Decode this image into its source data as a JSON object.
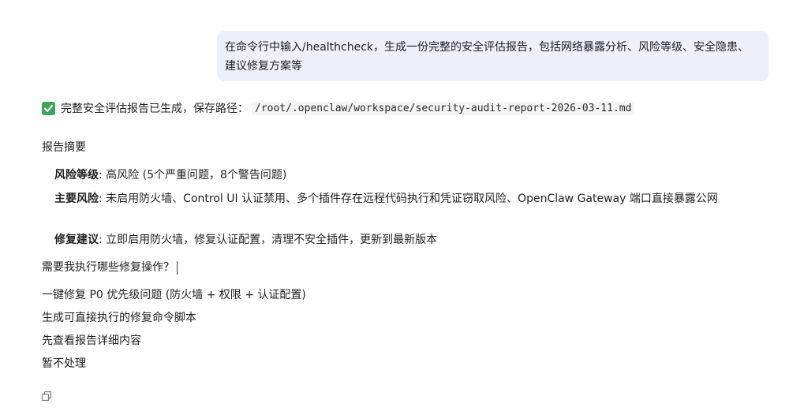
{
  "user_message": "在命令行中输入/healthcheck，生成一份完整的安全评估报告，包括网络暴露分析、风险等级、安全隐患、建议修复方案等",
  "status": {
    "icon": "check-box-icon",
    "text": "完整安全评估报告已生成，保存路径：",
    "path": "/root/.openclaw/workspace/security-audit-report-2026-03-11.md"
  },
  "summary": {
    "title": "报告摘要",
    "items": [
      {
        "label": "风险等级",
        "text": ": 高风险 (5个严重问题，8个警告问题)"
      },
      {
        "label": "主要风险",
        "text": ": 未启用防火墙、Control UI 认证禁用、多个插件存在远程代码执行和凭证窃取风险、OpenClaw Gateway 端口直接暴露公网"
      },
      {
        "label": "修复建议",
        "text": ": 立即启用防火墙，修复认证配置，清理不安全插件，更新到最新版本"
      }
    ]
  },
  "question": "需要我执行哪些修复操作？",
  "options": [
    "一键修复 P0 优先级问题 (防火墙 + 权限 + 认证配置)",
    "生成可直接执行的修复命令脚本",
    "先查看报告详细内容",
    "暂不处理"
  ],
  "copy_icon": "copy-icon",
  "colors": {
    "bubble_bg": "#eef0f8",
    "check_green": "#3ba55c"
  }
}
